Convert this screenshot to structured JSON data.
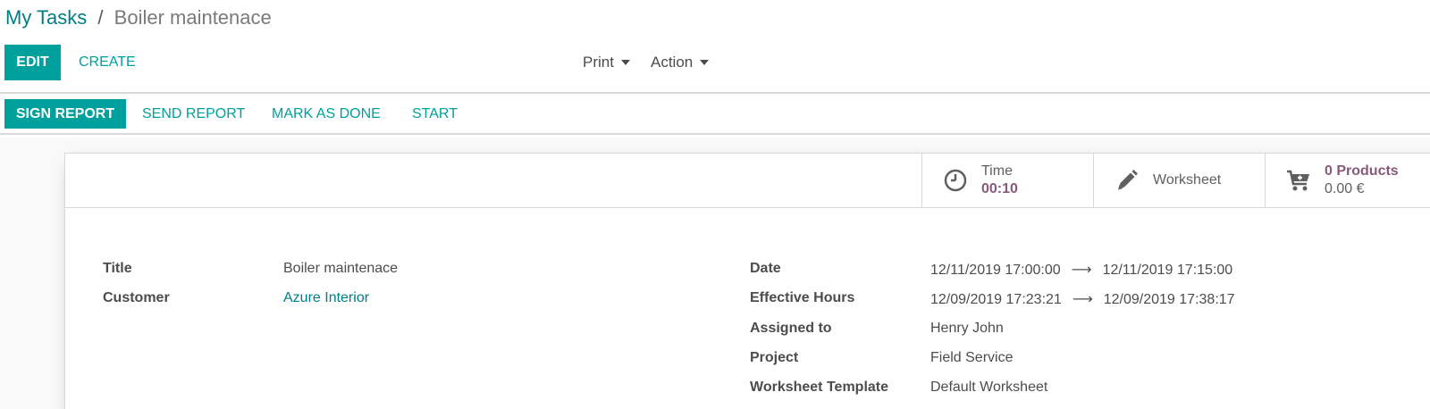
{
  "breadcrumb": {
    "parent": "My Tasks",
    "separator": "/",
    "current": "Boiler maintenace"
  },
  "toolbar": {
    "edit_label": "EDIT",
    "create_label": "CREATE",
    "print_label": "Print",
    "action_label": "Action"
  },
  "statusbar": {
    "sign_report": "SIGN REPORT",
    "send_report": "SEND REPORT",
    "mark_as_done": "MARK AS DONE",
    "start": "START"
  },
  "smart_buttons": {
    "time": {
      "label": "Time",
      "value": "00:10",
      "icon": "clock-icon"
    },
    "worksheet": {
      "label": "Worksheet",
      "icon": "pencil-icon"
    },
    "products": {
      "label": "0 Products",
      "sub": "0.00 €",
      "icon": "cart-plus-icon"
    }
  },
  "form": {
    "title": {
      "label": "Title",
      "value": "Boiler maintenace"
    },
    "customer": {
      "label": "Customer",
      "value": "Azure Interior"
    },
    "date": {
      "label": "Date",
      "start": "12/11/2019 17:00:00",
      "end": "12/11/2019 17:15:00"
    },
    "effective_hours": {
      "label": "Effective Hours",
      "start": "12/09/2019 17:23:21",
      "end": "12/09/2019 17:38:17"
    },
    "assigned_to": {
      "label": "Assigned to",
      "value": "Henry John"
    },
    "project": {
      "label": "Project",
      "value": "Field Service"
    },
    "worksheet_template": {
      "label": "Worksheet Template",
      "value": "Default Worksheet"
    }
  },
  "colors": {
    "primary": "#00a09d",
    "link": "#017e84",
    "accent": "#875a7b"
  }
}
